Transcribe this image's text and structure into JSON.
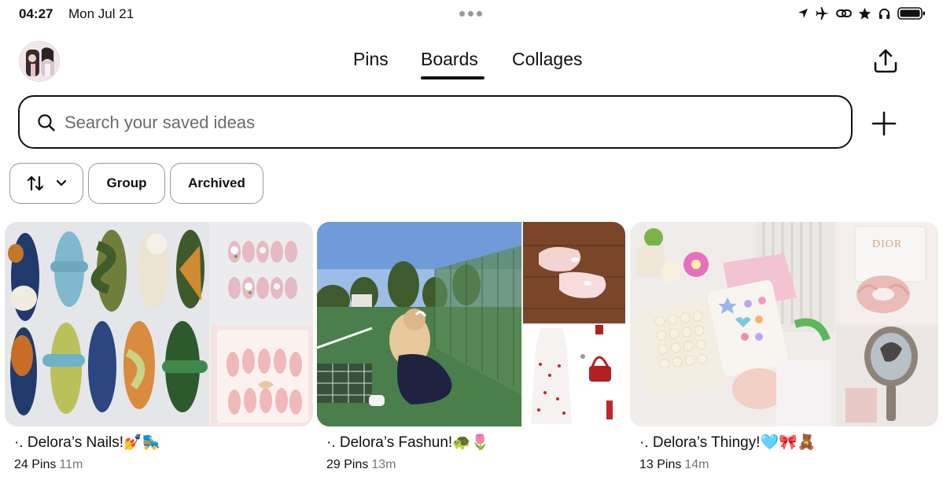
{
  "status_bar": {
    "time": "04:27",
    "date": "Mon Jul 21",
    "icons": [
      "location-arrow-icon",
      "airplane-icon",
      "link-icon",
      "star-icon",
      "headphones-icon",
      "battery-icon"
    ]
  },
  "header": {
    "tabs": [
      {
        "label": "Pins",
        "selected": false
      },
      {
        "label": "Boards",
        "selected": true
      },
      {
        "label": "Collages",
        "selected": false
      }
    ]
  },
  "search": {
    "placeholder": "Search your saved ideas",
    "value": ""
  },
  "filters": {
    "sort_icon": "sort-arrows-icon",
    "group_label": "Group",
    "archived_label": "Archived"
  },
  "boards": [
    {
      "title": "·. Delora’s Nails!💅🛼",
      "pin_count": "24 Pins",
      "age": "11m"
    },
    {
      "title": "·. Delora’s Fashun!🐢🌷",
      "pin_count": "29 Pins",
      "age": "13m"
    },
    {
      "title": "·. Delora’s Thingy!🩵🎀🧸",
      "pin_count": "13 Pins",
      "age": "14m"
    }
  ],
  "colors": {
    "text": "#111111",
    "muted": "#767676",
    "chip_border": "#999999"
  }
}
